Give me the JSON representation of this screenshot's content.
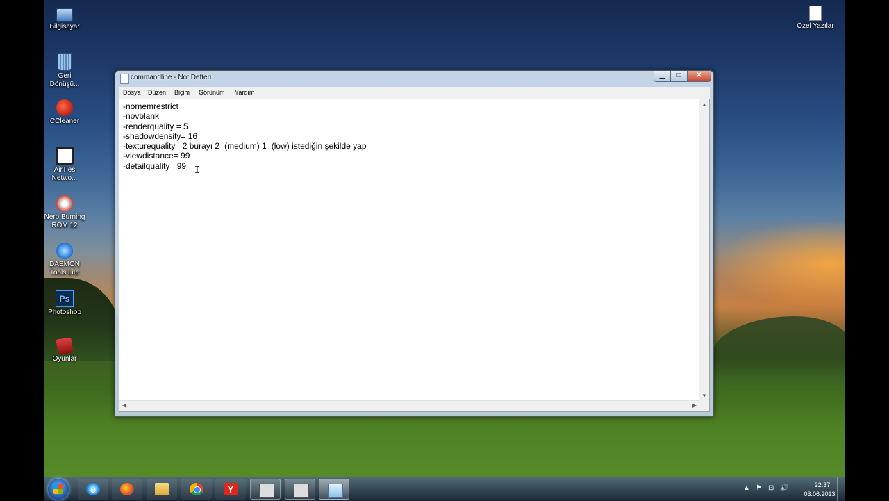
{
  "desktop": {
    "icons_left": [
      {
        "label": "Bilgisayar",
        "icon": "computer-icon"
      },
      {
        "label": "Geri\nDönüşü...",
        "icon": "recycle-bin-icon"
      },
      {
        "label": "CCleaner",
        "icon": "ccleaner-icon"
      },
      {
        "label": "AirTies\nNetwo...",
        "icon": "airties-icon"
      },
      {
        "label": "Nero Burning\nROM 12",
        "icon": "nero-icon"
      },
      {
        "label": "DAEMON\nTools Lite",
        "icon": "daemon-tools-icon"
      },
      {
        "label": "Photoshop",
        "icon": "photoshop-icon",
        "glyph": "Ps"
      },
      {
        "label": "Oyunlar",
        "icon": "games-folder-icon"
      }
    ],
    "icon_right": {
      "label": "Özel Yazılar",
      "icon": "document-icon"
    }
  },
  "notepad": {
    "title": "commandline - Not Defteri",
    "window_buttons": {
      "minimize": "▁",
      "maximize": "□",
      "close": "✕"
    },
    "menu": [
      "Dosya",
      "Düzen",
      "Biçim",
      "Görünüm",
      "Yardım"
    ],
    "lines": [
      "-nomemrestrict",
      "-novblank",
      "-renderquality = 5",
      "-shadowdensity= 16",
      "-texturequality= 2 burayı 2=(medium) 1=(low) istediğin şekilde yap",
      "-viewdistance= 99",
      "-detailquality= 99"
    ],
    "ibeam": "I"
  },
  "taskbar": {
    "apps": [
      {
        "name": "internet-explorer",
        "state": "pinned",
        "glyph": "e"
      },
      {
        "name": "firefox",
        "state": "pinned"
      },
      {
        "name": "file-explorer",
        "state": "pinned"
      },
      {
        "name": "chrome",
        "state": "pinned"
      },
      {
        "name": "yandex-browser",
        "state": "pinned",
        "glyph": "Y"
      },
      {
        "name": "command-prompt",
        "state": "running"
      },
      {
        "name": "command-prompt-2",
        "state": "running"
      },
      {
        "name": "notepad",
        "state": "active"
      }
    ],
    "tray": {
      "icons": [
        "▲",
        "⚑",
        "⊡",
        "🔊"
      ]
    },
    "clock": {
      "time": "22:37",
      "date": "03.06.2013"
    }
  }
}
